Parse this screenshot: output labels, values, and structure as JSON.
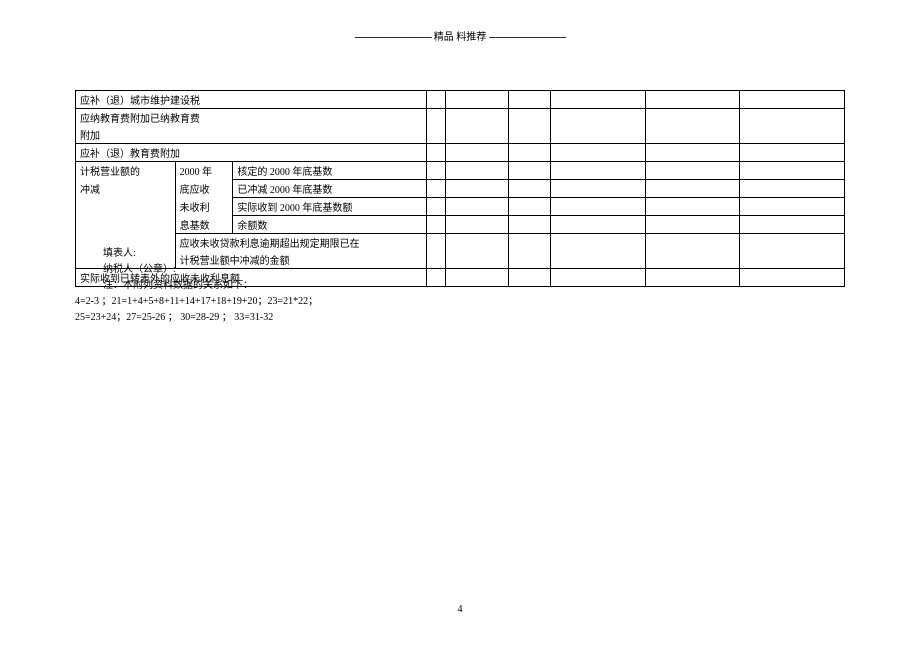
{
  "header": {
    "dashes_left": "---------------------------------",
    "title": "精品  料推荐",
    "dashes_right": "---------------------------------"
  },
  "table": {
    "row1": "应补（退）城市维护建设税",
    "row2": "应纳教育费附加已纳教育费",
    "row3": "附加",
    "row4": "应补（退）教育费附加",
    "row5_a": "计税营业额的",
    "row5_b": "2000 年",
    "row5_c": "核定的  2000 年底基数",
    "row6_a": "冲减",
    "row6_b": "底应收",
    "row6_c": "已冲减  2000 年底基数",
    "row7_b": "未收利",
    "row7_c": "实际收到  2000 年底基数额",
    "row8_b": "息基数",
    "row8_c": "余额数",
    "row9_c1": "应收未收贷款利息逾期超出规定期限已在",
    "row9_c2": "计税营业额中冲减的金额",
    "row10": "实际收到已转表外的应收未收利息额"
  },
  "footer": {
    "line1": "填表人:",
    "line2": "纳税人（公章）:",
    "line3": "注：本附列资料数据的关系如下：",
    "line4": "4=2-3 ；21=1+4+5+8+11+14+17+18+19+20；23=21*22；",
    "line5": "25=23+24；27=25-26 ；                    30=28-29               ；     33=31-32"
  },
  "page": "4"
}
